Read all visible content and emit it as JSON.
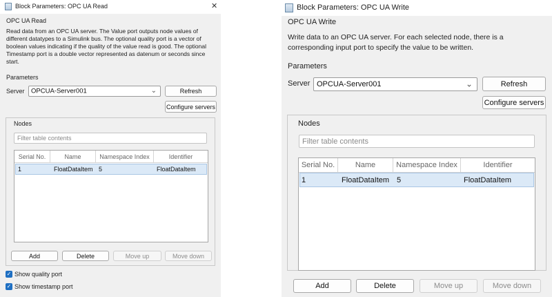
{
  "read_dialog": {
    "window_title": "Block Parameters: OPC UA Read",
    "close_symbol": "✕",
    "heading": "OPC UA Read",
    "description": "Read data from an OPC UA server. The Value port outputs node values of different datatypes to a Simulink bus. The optional quality port is a vector of boolean values indicating if the quality of the value read is good. The optional Timestamp port is a double vector represented as datenum or seconds since start.",
    "parameters_label": "Parameters",
    "server_label": "Server",
    "server_value": "OPCUA-Server001",
    "refresh_label": "Refresh",
    "configure_label": "Configure servers",
    "nodes_label": "Nodes",
    "filter_placeholder": "Filter table contents",
    "columns": [
      "Serial No.",
      "Name",
      "Namespace Index",
      "Identifier"
    ],
    "rows": [
      {
        "serial": "1",
        "name": "FloatDataItem",
        "namespace": "5",
        "identifier": "FloatDataItem"
      }
    ],
    "add_label": "Add",
    "delete_label": "Delete",
    "move_up_label": "Move up",
    "move_down_label": "Move down",
    "show_quality_label": "Show quality port",
    "show_quality_checked": true,
    "show_timestamp_label": "Show timestamp port",
    "show_timestamp_checked": true
  },
  "write_dialog": {
    "window_title": "Block Parameters: OPC UA Write",
    "heading": "OPC UA Write",
    "description": "Write data to an OPC UA server. For each selected node, there is a corresponding input port to specify the value to be written.",
    "parameters_label": "Parameters",
    "server_label": "Server",
    "server_value": "OPCUA-Server001",
    "refresh_label": "Refresh",
    "configure_label": "Configure servers",
    "nodes_label": "Nodes",
    "filter_placeholder": "Filter table contents",
    "columns": [
      "Serial No.",
      "Name",
      "Namespace Index",
      "Identifier"
    ],
    "rows": [
      {
        "serial": "1",
        "name": "FloatDataItem",
        "namespace": "5",
        "identifier": "FloatDataItem"
      }
    ],
    "add_label": "Add",
    "delete_label": "Delete",
    "move_up_label": "Move up",
    "move_down_label": "Move down"
  },
  "icons": {
    "chevron": "⌄",
    "check": "✓"
  },
  "colors": {
    "selection": "#dbe9f7",
    "checkbox": "#1f6fc2",
    "dialog_bg": "#f0f0f0"
  }
}
